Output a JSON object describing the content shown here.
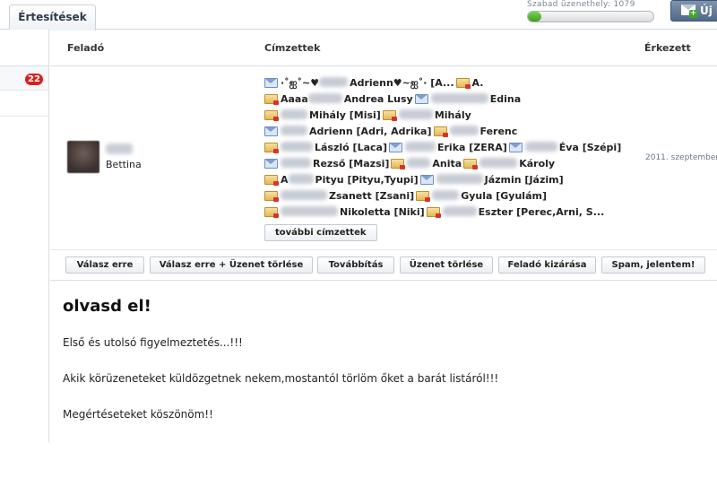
{
  "tab": {
    "label": "Értesítések"
  },
  "storage": {
    "label": "Szabad üzenethely: 1079",
    "fill_percent": 11
  },
  "new_button": {
    "label": "Új ü"
  },
  "sidebar": {
    "badge": "22"
  },
  "columns": {
    "sender": "Feladó",
    "recipients": "Címzettek",
    "received": "Érkezett"
  },
  "message": {
    "sender": {
      "name": "Bettina"
    },
    "received": "2011. szeptember",
    "recipient_lines": [
      [
        {
          "icon": "mail",
          "blur": 32,
          "text": "·˚ஐ˚~♥",
          "after": "Adrienn♥~ஐ˚· [A..."
        },
        {
          "icon": "contact",
          "text": "A."
        }
      ],
      [
        {
          "icon": "contact",
          "text": "Aaaa",
          "blur": 38,
          "after": "Andrea Lusy"
        },
        {
          "icon": "mail",
          "blur": 64,
          "after": "Edina"
        }
      ],
      [
        {
          "icon": "contact",
          "blur": 30,
          "after": "Mihály [Misi]"
        },
        {
          "icon": "contact",
          "blur": 38,
          "after": "Mihály"
        }
      ],
      [
        {
          "icon": "mail",
          "blur": 30,
          "after": "Adrienn [Adri, Adrika]"
        },
        {
          "icon": "contact",
          "blur": 32,
          "after": "Ferenc"
        }
      ],
      [
        {
          "icon": "contact",
          "blur": 36,
          "after": "László [Laca]"
        },
        {
          "icon": "mail",
          "blur": 34,
          "after": "Erika [ZERA]"
        },
        {
          "icon": "mail",
          "blur": 36,
          "after": "Éva [Szépi]"
        }
      ],
      [
        {
          "icon": "mail",
          "blur": 34,
          "after": "Rezső [Mazsi]"
        },
        {
          "icon": "contact",
          "blur": 26,
          "after": "Anita"
        },
        {
          "icon": "contact",
          "blur": 42,
          "after": "Károly"
        }
      ],
      [
        {
          "icon": "contact",
          "text": "A",
          "blur": 28,
          "after": "Pityu [Pityu,Tyupi]"
        },
        {
          "icon": "mail",
          "blur": 52,
          "after": "Jázmin [Jázim]"
        }
      ],
      [
        {
          "icon": "contact",
          "blur": 52,
          "after": "Zsanett [Zsani]"
        },
        {
          "icon": "contact",
          "blur": 30,
          "after": "Gyula [Gyulám]"
        }
      ],
      [
        {
          "icon": "contact",
          "blur": 64,
          "after": "Nikoletta [Niki]"
        },
        {
          "icon": "contact",
          "blur": 38,
          "after": "Eszter [Perec,Arni, S..."
        }
      ]
    ],
    "more_recipients": "további címzettek",
    "subject": "olvasd el!",
    "body": [
      "Első és utolsó figyelmeztetés...!!!",
      "Akik körüzeneteket küldözgetnek nekem,mostantól törlöm őket a barát listáról!!!",
      "Megértéseteket köszönöm!!"
    ]
  },
  "actions": {
    "reply": "Válasz erre",
    "reply_delete": "Válasz erre + Üzenet törlése",
    "forward": "Továbbítás",
    "delete": "Üzenet törlése",
    "block": "Feladó kizárása",
    "spam": "Spam, jelentem!"
  }
}
